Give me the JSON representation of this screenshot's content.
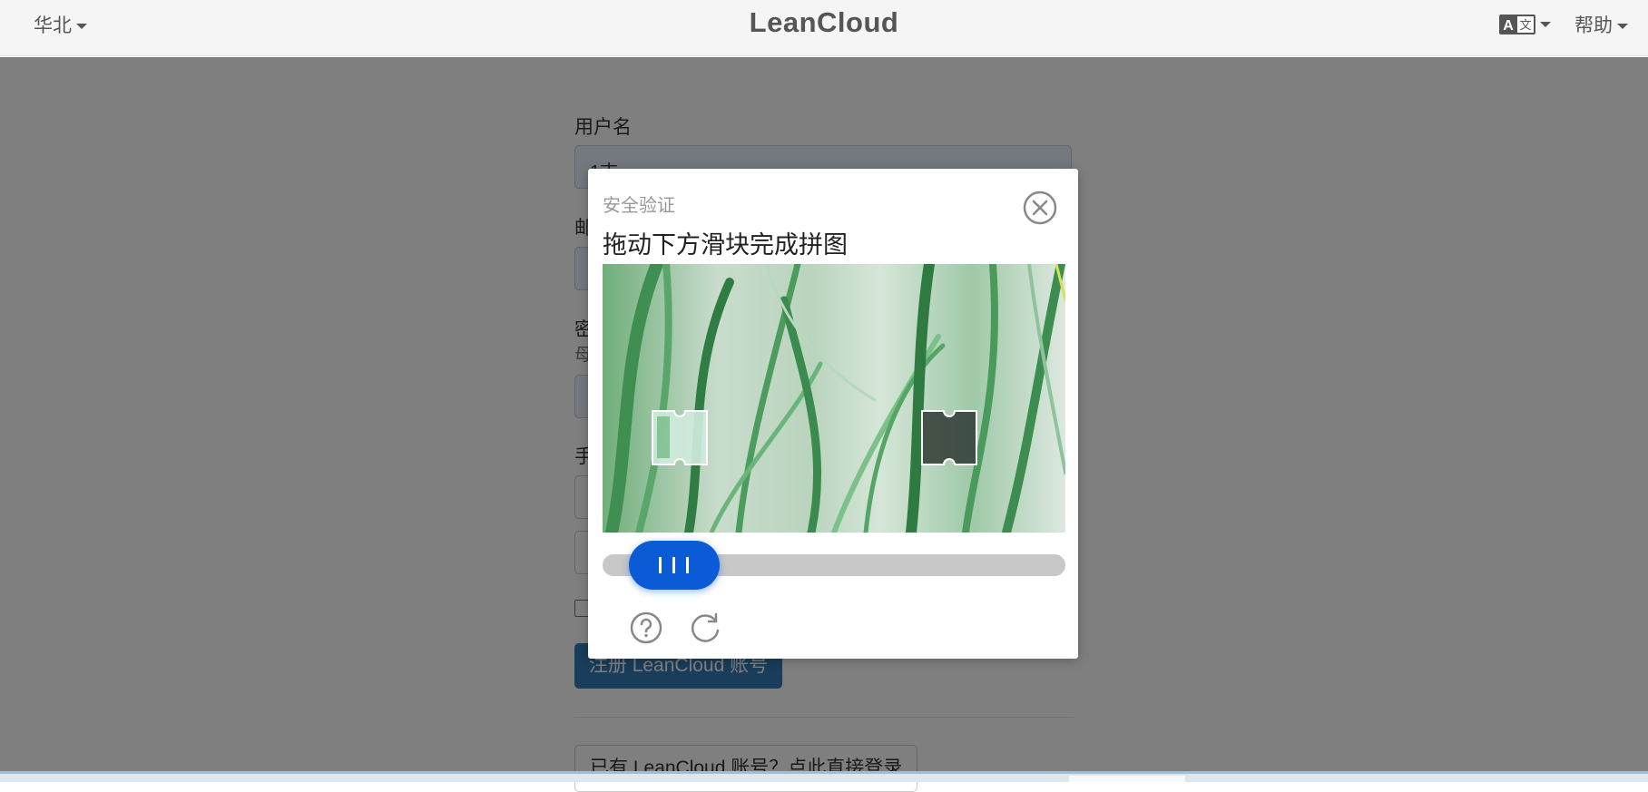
{
  "navbar": {
    "region_label": "华北",
    "brand": "LeanCloud",
    "language_icon": "language-icon",
    "help_label": "帮助"
  },
  "form": {
    "username_label": "用户名",
    "username_value": "1吉",
    "email_label_partial": "邮",
    "password_label_partial": "密",
    "password_help_partial": "母",
    "phone_label_partial": "手",
    "submit_label": "注册 LeanCloud 账号",
    "login_link": "已有 LeanCloud 账号？点此直接登录"
  },
  "captcha": {
    "title": "安全验证",
    "instruction": "拖动下方滑块完成拼图",
    "slider_progress": 0.07,
    "icons": {
      "close": "close-circle-icon",
      "help": "question-circle-icon",
      "refresh": "refresh-icon",
      "handle": "grip-lines-icon"
    }
  },
  "colors": {
    "slider_handle": "#0b5bd6",
    "submit_button": "#337ab7",
    "overlay": "rgba(0,0,0,0.5)"
  }
}
